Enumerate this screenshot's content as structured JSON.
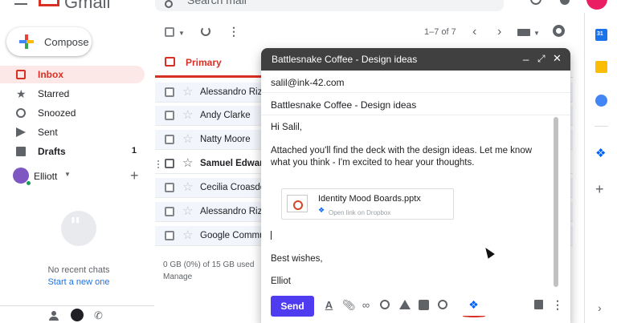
{
  "app": {
    "logo_text": "Gmail"
  },
  "search": {
    "placeholder": "Search mail"
  },
  "compose_button": {
    "label": "Compose"
  },
  "nav": {
    "items": [
      {
        "label": "Inbox",
        "icon": "inbox-icon",
        "count": ""
      },
      {
        "label": "Starred",
        "icon": "star-icon",
        "count": ""
      },
      {
        "label": "Snoozed",
        "icon": "clock-icon",
        "count": ""
      },
      {
        "label": "Sent",
        "icon": "send-icon",
        "count": ""
      },
      {
        "label": "Drafts",
        "icon": "draft-icon",
        "count": "1"
      }
    ]
  },
  "hangouts": {
    "user_name": "Elliott",
    "empty_text": "No recent chats",
    "start_link": "Start a new one"
  },
  "toolbar": {
    "pagination": "1–7 of 7"
  },
  "tabs": {
    "primary_label": "Primary"
  },
  "emails": [
    {
      "sender": "Alessandro Rizzo",
      "unread": false
    },
    {
      "sender": "Andy Clarke",
      "unread": false
    },
    {
      "sender": "Natty Moore",
      "unread": false
    },
    {
      "sender": "Samuel Edwards",
      "unread": true
    },
    {
      "sender": "Cecilia Croasdell",
      "unread": false
    },
    {
      "sender": "Alessandro Rizzo",
      "unread": false
    },
    {
      "sender": "Google Community",
      "unread": false
    }
  ],
  "storage": {
    "usage": "0 GB (0%) of 15 GB used",
    "manage_label": "Manage"
  },
  "compose": {
    "title": "Battlesnake Coffee - Design ideas",
    "to": "salil@ink-42.com",
    "subject": "Battlesnake Coffee - Design ideas",
    "greeting": "Hi Salil,",
    "paragraph": "Attached you'll find the deck with the design ideas. Let me know what you think - I'm excited to hear your thoughts.",
    "attachment": {
      "name": "Identity Mood Boards.pptx",
      "link_text": "Open link on Dropbox"
    },
    "signoff": "Best wishes,",
    "signature": "Elliot",
    "send_label": "Send"
  },
  "side_panel": {
    "calendar_label": "31"
  },
  "colors": {
    "accent_red": "#d93025",
    "send_button": "#4f3cf0",
    "dropbox_blue": "#0061ff",
    "compose_header": "#404040"
  }
}
